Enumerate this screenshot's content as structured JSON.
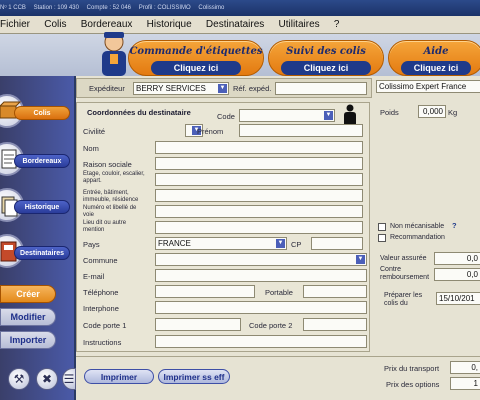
{
  "window": {
    "title_parts": [
      "Nᵒ 1 CCB",
      "Station : 109 430",
      "Compte : 52 046",
      "Profil : COLISSIMO",
      "Colissimo"
    ]
  },
  "menu": [
    "Fichier",
    "Colis",
    "Bordereaux",
    "Historique",
    "Destinataires",
    "Utilitaires",
    "?"
  ],
  "tabs": [
    {
      "title": "Commande d'étiquettes",
      "link": "Cliquez ici"
    },
    {
      "title": "Suivi des colis",
      "link": "Cliquez ici"
    },
    {
      "title": "Aide",
      "link": "Cliquez ici"
    }
  ],
  "sidebar": {
    "items": [
      {
        "label": "Colis",
        "active": true,
        "icon": "package-icon"
      },
      {
        "label": "Bordereaux",
        "active": false,
        "icon": "document-icon"
      },
      {
        "label": "Historique",
        "active": false,
        "icon": "history-icon"
      },
      {
        "label": "Destinataires",
        "active": false,
        "icon": "address-book-icon"
      }
    ],
    "actions": {
      "create": "Créer",
      "modify": "Modifier",
      "import": "Importer"
    },
    "tools": [
      "tools-icon",
      "no-entry-icon",
      "document-icon"
    ]
  },
  "shipper": {
    "label": "Expéditeur",
    "value": "BERRY SERVICES",
    "ref_label": "Réf. expéd.",
    "ref_value": ""
  },
  "recipient": {
    "section_title": "Coordonnées du destinataire",
    "code_label": "Code",
    "civility_label": "Civilité",
    "firstname_label": "Prénom",
    "name_label": "Nom",
    "company_label": "Raison sociale",
    "floor_label": "Etage, couloir, escalier, appart.",
    "building_label": "Entrée, bâtiment, immeuble, résidence",
    "street_label": "Numéro et libellé de voie",
    "place_label": "Lieu dit ou autre mention",
    "country_label": "Pays",
    "country_value": "FRANCE",
    "cp_label": "CP",
    "city_label": "Commune",
    "email_label": "E-mail",
    "phone_label": "Téléphone",
    "mobile_label": "Portable",
    "intercom_label": "Interphone",
    "door1_label": "Code porte 1",
    "door2_label": "Code porte 2",
    "instructions_label": "Instructions"
  },
  "product": {
    "value": "Colissimo Expert France",
    "weight_label": "Poids",
    "weight_value": "0,000",
    "weight_unit": "Kg",
    "non_mech_label": "Non mécanisable",
    "help": "?",
    "recommend_label": "Recommandation",
    "insured_label": "Valeur assurée",
    "insured_value": "0,0",
    "cod_label": "Contre remboursement",
    "cod_value": "0,0",
    "prepare_label": "Préparer les colis du",
    "prepare_value": "15/10/201"
  },
  "footer": {
    "print": "Imprimer",
    "print_no_label": "Imprimer ss eff",
    "transport_label": "Prix du transport",
    "transport_value": "0,",
    "options_label": "Prix des options",
    "options_value": "1"
  }
}
